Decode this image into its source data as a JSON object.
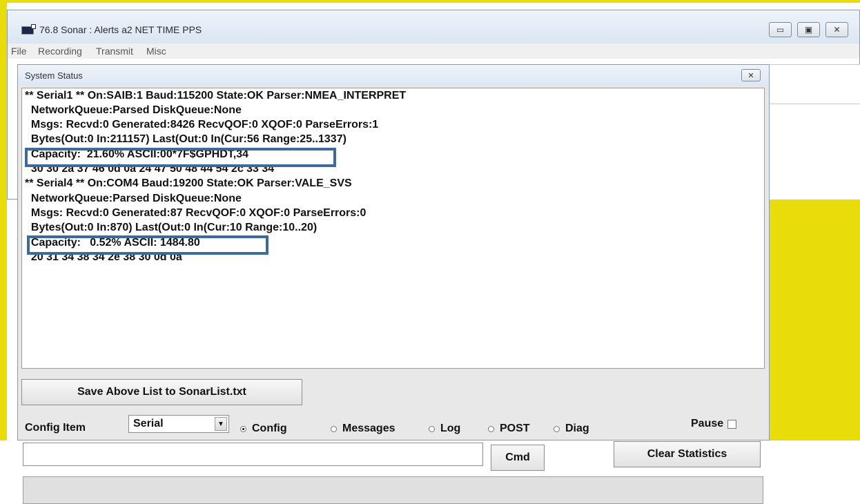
{
  "window": {
    "title": "76.8 Sonar : Alerts a2 NET TIME PPS",
    "minimize": "▭",
    "maximize": "▣",
    "close": "✕"
  },
  "menu": [
    "File",
    "Recording",
    "Transmit",
    "Misc"
  ],
  "status_window": {
    "title": "System Status",
    "close": "✕"
  },
  "list": [
    "** Serial1 ** On:SAIB:1 Baud:115200 State:OK Parser:NMEA_INTERPRET",
    "  NetworkQueue:Parsed DiskQueue:None",
    "  Msgs: Recvd:0 Generated:8426 RecvQOF:0 XQOF:0 ParseErrors:1",
    "  Bytes(Out:0 In:211157) Last(Out:0 In(Cur:56 Range:25..1337)",
    "  Capacity:  21.60% ASCII:00*7F$GPHDT,34",
    "  30 30 2a 37 46 0d 0a 24 47 50 48 44 54 2c 33 34",
    "** Serial4 ** On:COM4 Baud:19200 State:OK Parser:VALE_SVS",
    "  NetworkQueue:Parsed DiskQueue:None",
    "  Msgs: Recvd:0 Generated:87 RecvQOF:0 XQOF:0 ParseErrors:0",
    "  Bytes(Out:0 In:870) Last(Out:0 In(Cur:10 Range:10..20)",
    "  Capacity:   0.52% ASCII: 1484.80",
    "  20 31 34 38 34 2e 38 30 0d 0a"
  ],
  "controls": {
    "save_label": "Save Above List to SonarList.txt",
    "config_label": "Config Item",
    "select_value": "Serial",
    "radios": [
      "Config",
      "Messages",
      "Log",
      "POST",
      "Diag"
    ],
    "selected_radio": "Config",
    "pause_label": "Pause",
    "cmd_label": "Cmd",
    "clear_label": "Clear Statistics",
    "cmd_value": ""
  },
  "colors": {
    "desktop_yellow": "#e8dc0a",
    "highlight_border": "#3e6a9a"
  }
}
